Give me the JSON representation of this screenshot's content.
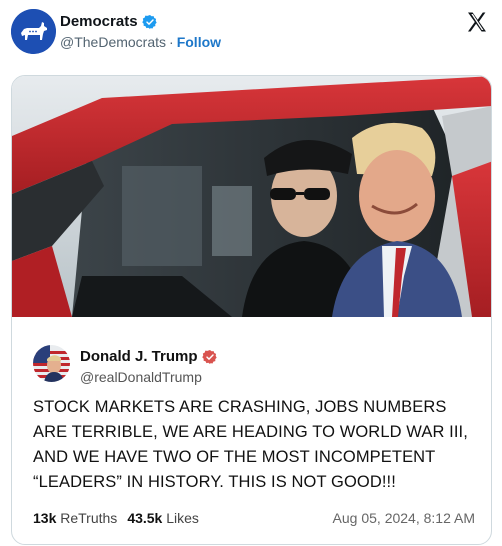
{
  "header": {
    "account_name": "Democrats",
    "handle": "@TheDemocrats",
    "separator": "·",
    "follow_label": "Follow"
  },
  "truth": {
    "author_name": "Donald J. Trump",
    "author_handle": "@realDonaldTrump",
    "text": "STOCK MARKETS ARE CRASHING, JOBS NUMBERS ARE TERRIBLE, WE ARE HEADING TO WORLD WAR III, AND WE HAVE TWO OF THE MOST INCOMPETENT “LEADERS” IN HISTORY. THIS IS NOT GOOD!!!",
    "retruths_count": "13k",
    "retruths_label": "ReTruths",
    "likes_count": "43.5k",
    "likes_label": "Likes",
    "timestamp": "Aug 05, 2024, 8:12 AM"
  },
  "colors": {
    "democrats_blue": "#1d4fb3",
    "verified_blue": "#1d9bf0",
    "truth_verified_red": "#d9534f",
    "car_red": "#c8282b",
    "follow_link": "#1d77c9"
  },
  "icons": {
    "x_logo": "x-logo-icon",
    "verified": "verified-badge-icon",
    "donkey": "donkey-logo-icon"
  }
}
